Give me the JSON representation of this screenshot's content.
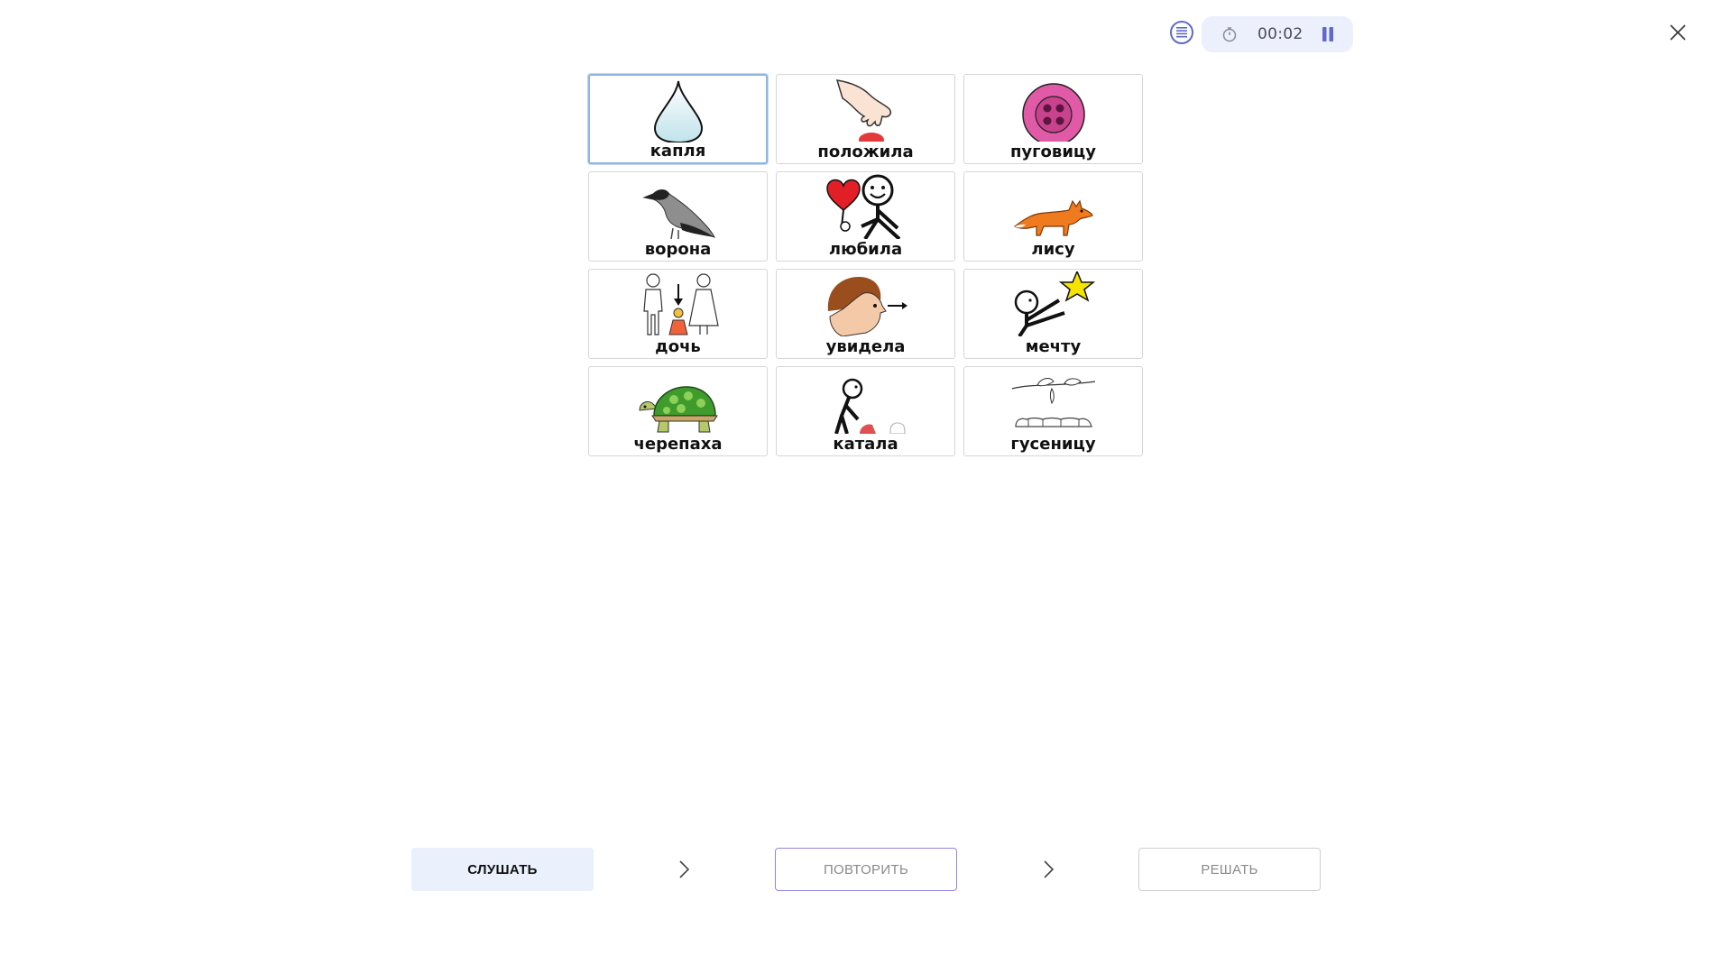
{
  "header": {
    "timer_value": "00:02",
    "icons": {
      "menu": "list-menu-icon",
      "timer": "stopwatch-icon",
      "pause": "pause-icon",
      "close": "close-icon"
    },
    "accent_color": "#5f6ac8"
  },
  "cards": [
    {
      "label": "капля",
      "icon": "water-drop",
      "selected": true
    },
    {
      "label": "положила",
      "icon": "hand-placing"
    },
    {
      "label": "пуговицу",
      "icon": "button"
    },
    {
      "label": "ворона",
      "icon": "crow"
    },
    {
      "label": "любила",
      "icon": "person-with-heart"
    },
    {
      "label": "лису",
      "icon": "fox"
    },
    {
      "label": "дочь",
      "icon": "parents-and-daughter"
    },
    {
      "label": "увидела",
      "icon": "person-looking"
    },
    {
      "label": "мечту",
      "icon": "person-reaching-star"
    },
    {
      "label": "черепаха",
      "icon": "turtle"
    },
    {
      "label": "катала",
      "icon": "person-rolling-ball"
    },
    {
      "label": "гусеницу",
      "icon": "caterpillar-on-branch"
    }
  ],
  "steps": {
    "listen_label": "СЛУШАТЬ",
    "repeat_label": "ПОВТОРИТЬ",
    "solve_label": "РЕШАТЬ"
  }
}
